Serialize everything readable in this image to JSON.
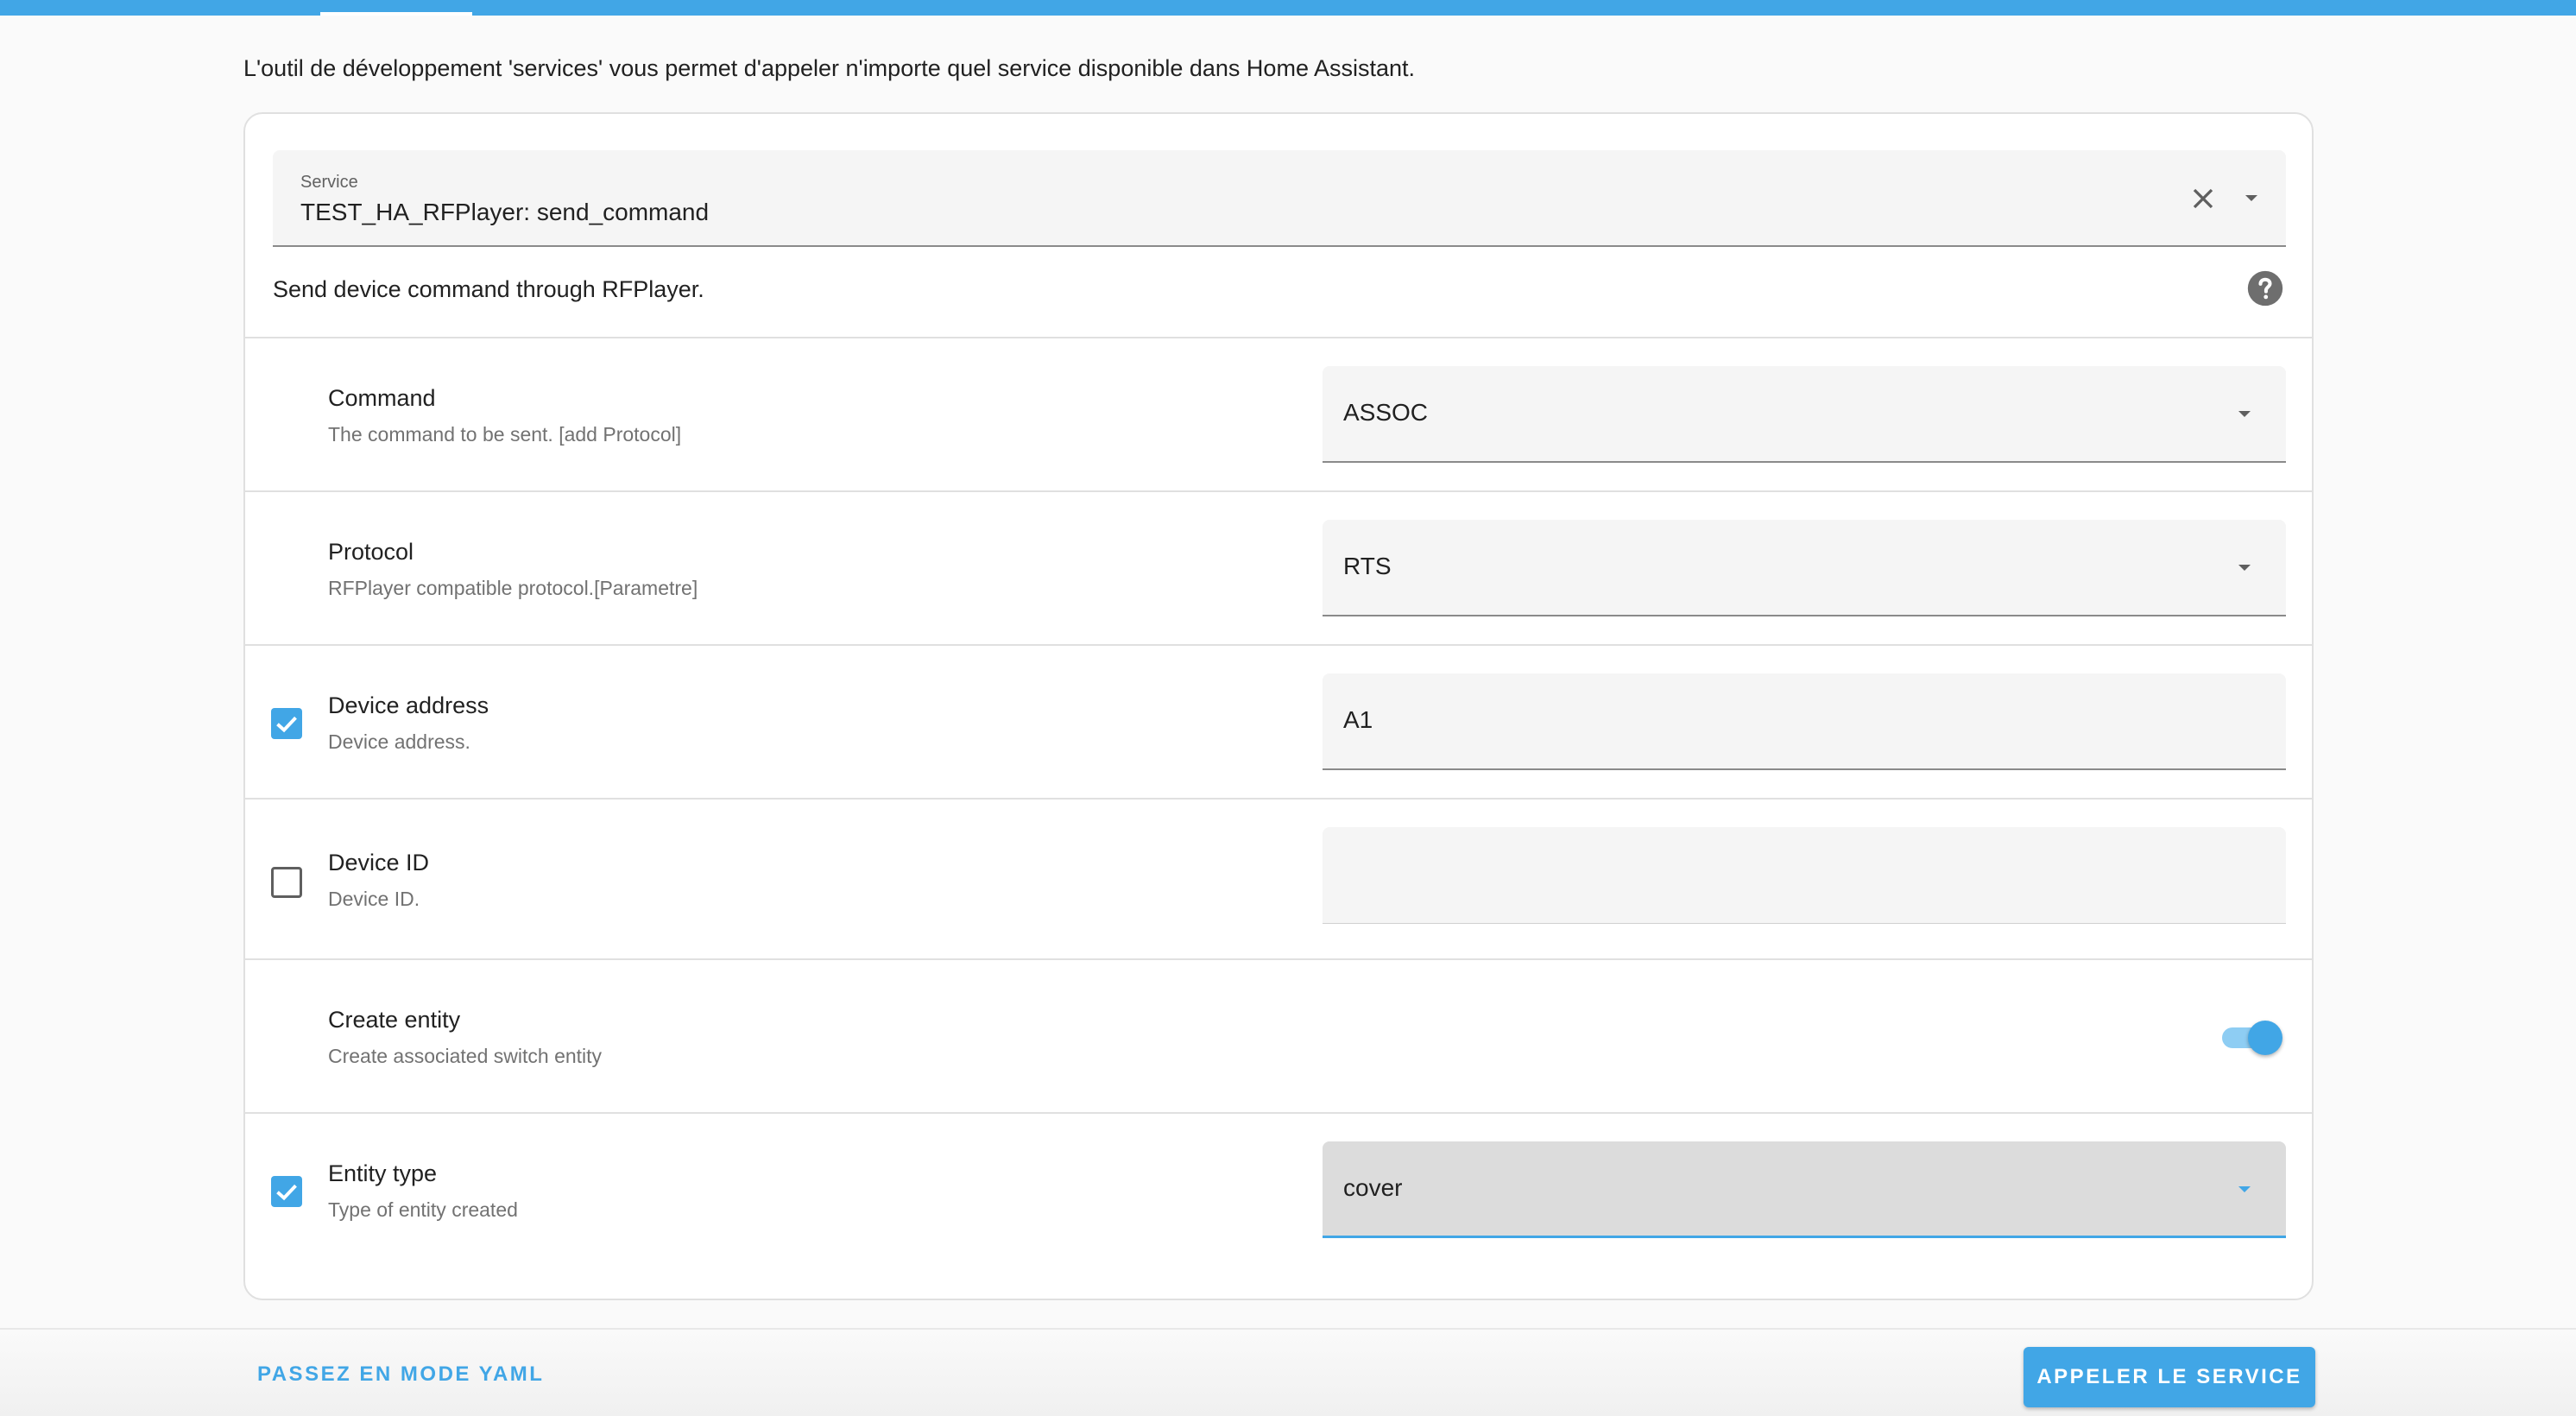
{
  "intro_text": "L'outil de développement 'services' vous permet d'appeler n'importe quel service disponible dans Home Assistant.",
  "service": {
    "label": "Service",
    "value": "TEST_HA_RFPlayer: send_command",
    "description": "Send device command through RFPlayer."
  },
  "fields": {
    "command": {
      "title": "Command",
      "description": "The command to be sent. [add Protocol]",
      "value": "ASSOC"
    },
    "protocol": {
      "title": "Protocol",
      "description": "RFPlayer compatible protocol.[Parametre]",
      "value": "RTS"
    },
    "device_address": {
      "title": "Device address",
      "description": "Device address.",
      "value": "A1",
      "enabled": true
    },
    "device_id": {
      "title": "Device ID",
      "description": "Device ID.",
      "value": "",
      "enabled": false
    },
    "create_entity": {
      "title": "Create entity",
      "description": "Create associated switch entity",
      "value": true
    },
    "entity_type": {
      "title": "Entity type",
      "description": "Type of entity created",
      "value": "cover",
      "enabled": true
    }
  },
  "footer": {
    "yaml_mode_label": "PASSEZ EN MODE YAML",
    "call_service_label": "APPELER LE SERVICE"
  },
  "colors": {
    "accent": "#41a6e6",
    "field_background": "#f5f5f5"
  },
  "icons": {
    "clear": "close-icon",
    "dropdown": "chevron-down-icon",
    "help": "help-circle-icon",
    "check": "checkmark-icon"
  }
}
